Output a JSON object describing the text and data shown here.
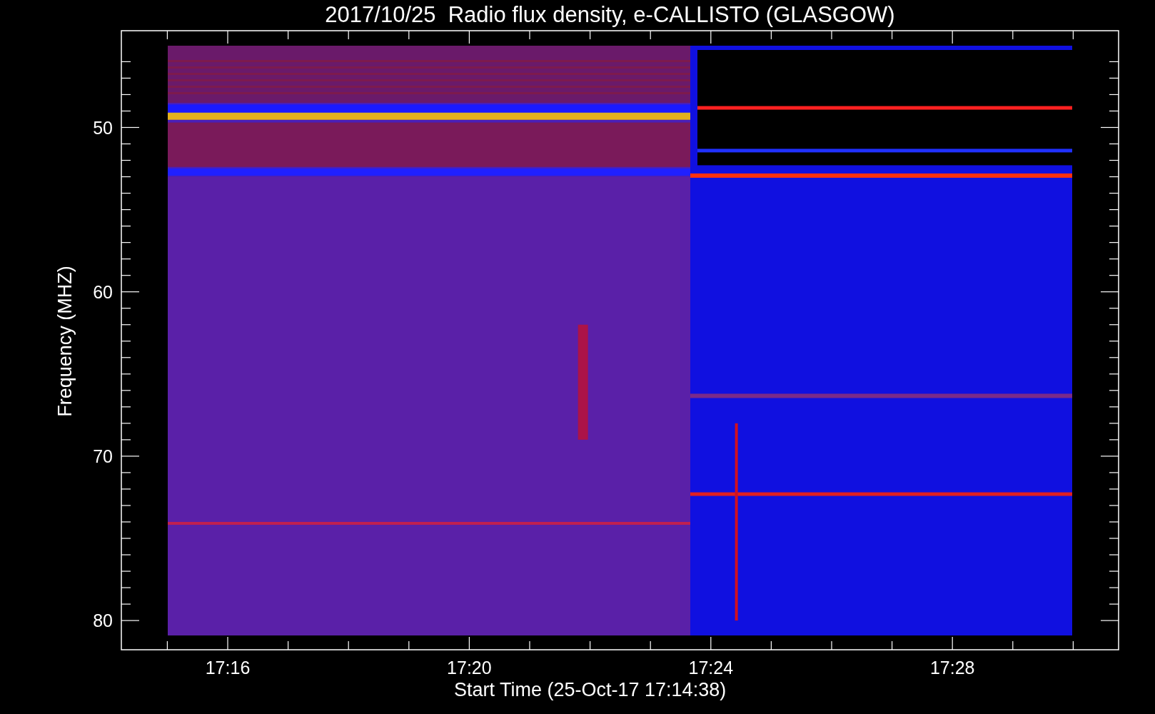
{
  "title": "2017/10/25  Radio flux density, e-CALLISTO (GLASGOW)",
  "y_axis": {
    "label": "Frequency (MHZ)",
    "ticks": [
      "50",
      "60",
      "70",
      "80"
    ]
  },
  "x_axis": {
    "label": "Start Time (25-Oct-17 17:14:38)",
    "ticks": [
      "17:16",
      "17:20",
      "17:24",
      "17:28"
    ]
  }
}
